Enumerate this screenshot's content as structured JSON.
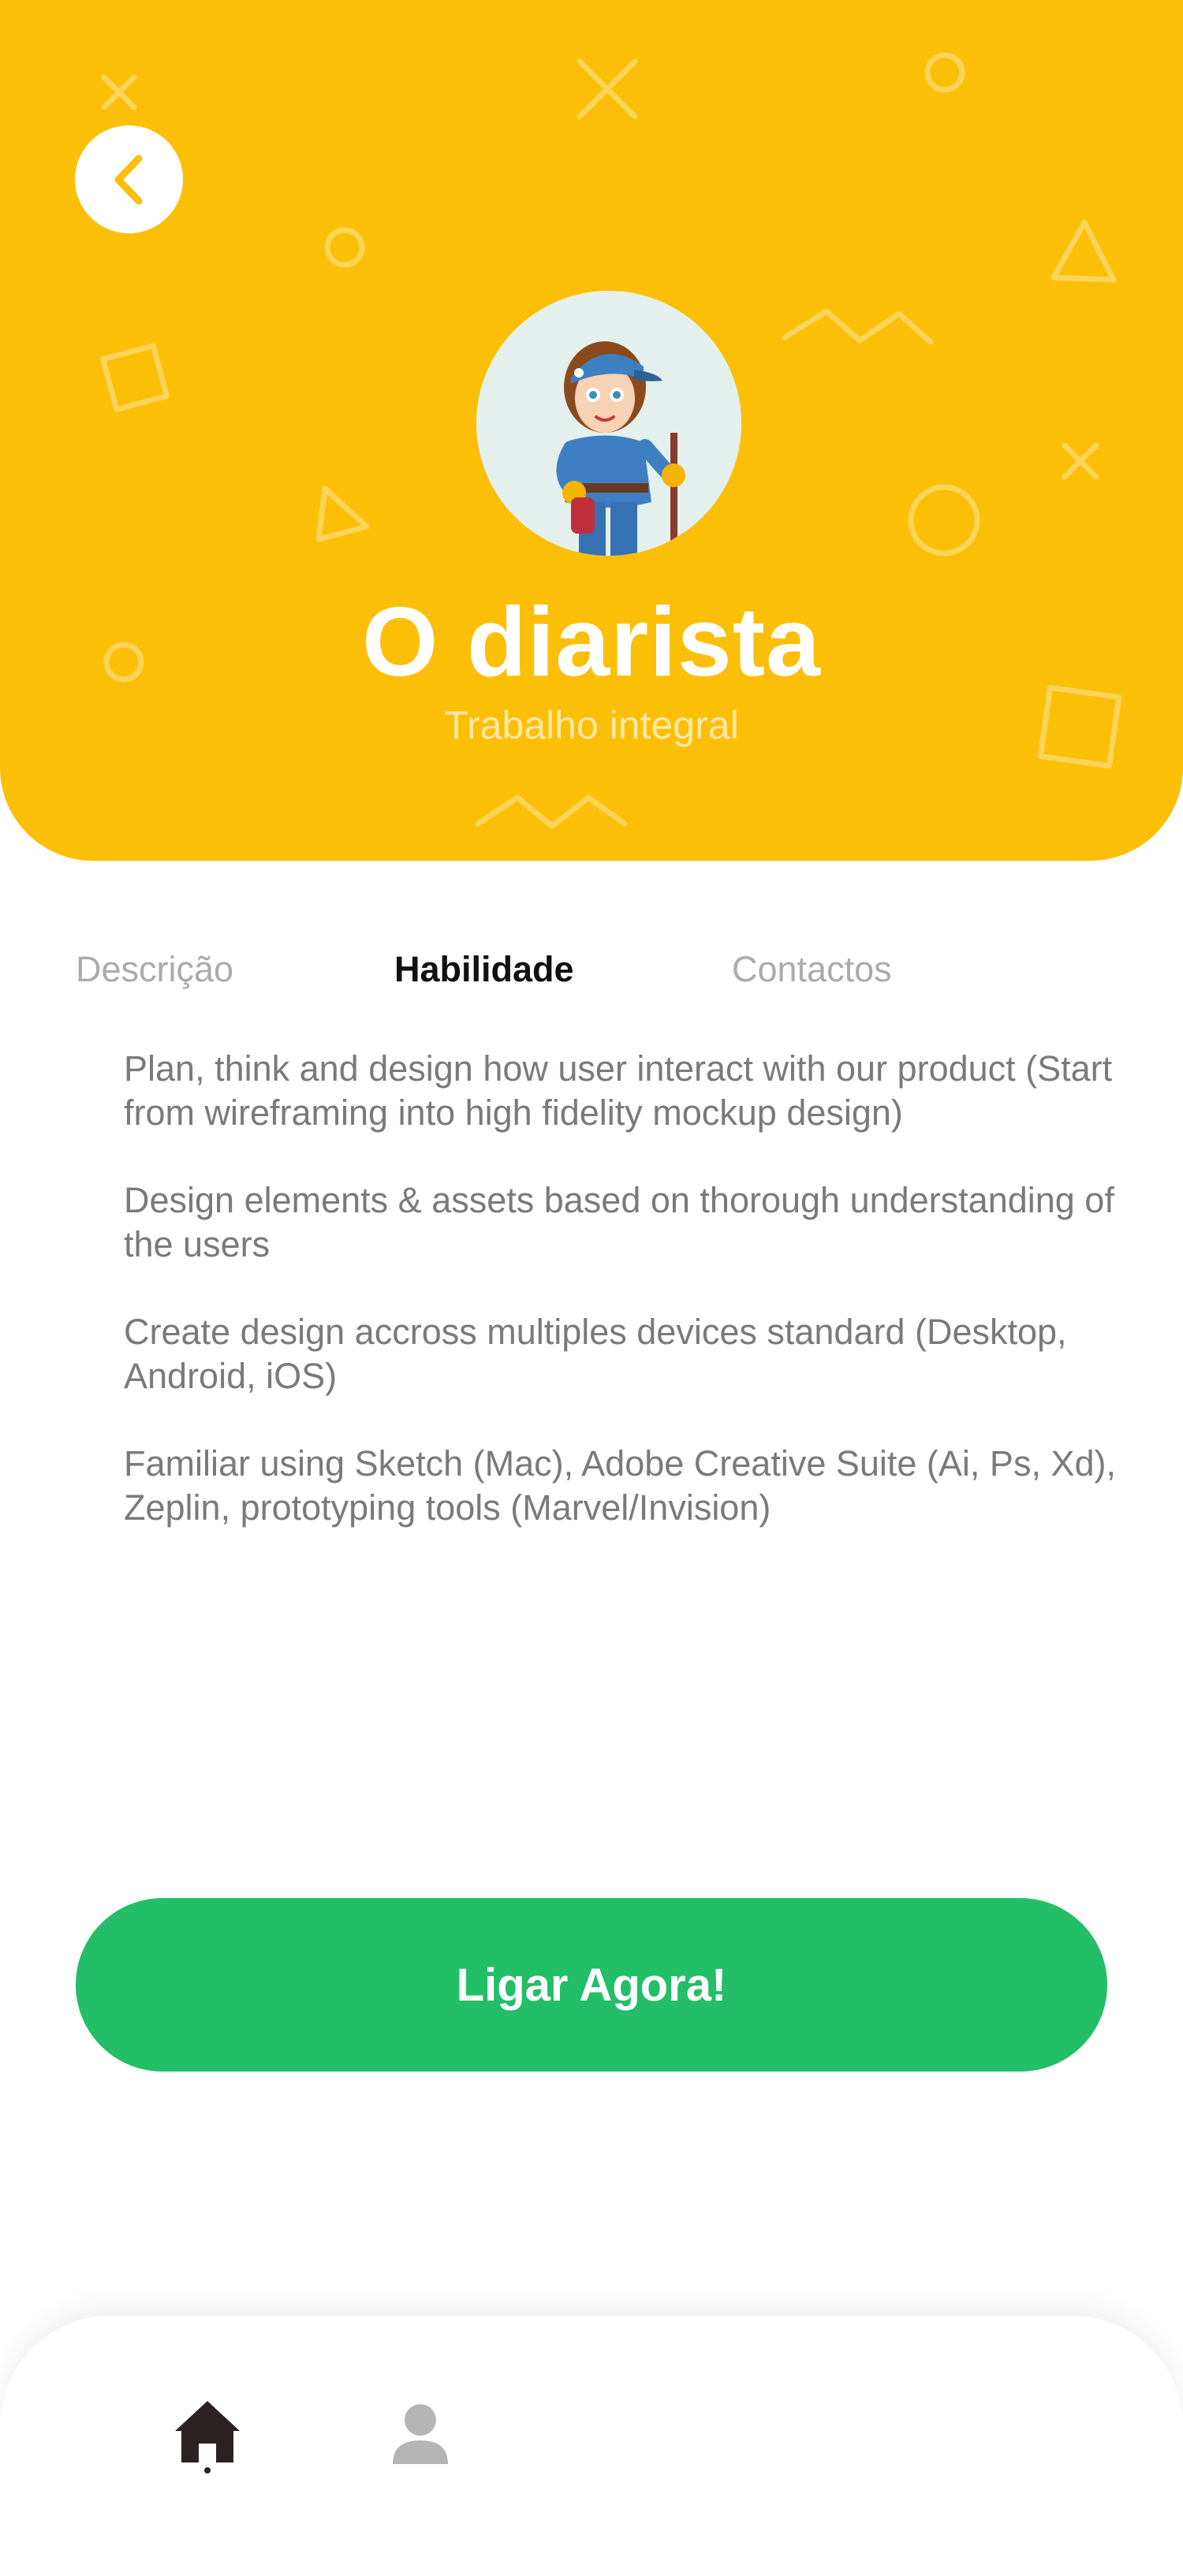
{
  "header": {
    "title": "O diarista",
    "subtitle": "Trabalho integral",
    "accent_color": "#FCBF08"
  },
  "back_button": {
    "icon": "chevron-left-icon"
  },
  "avatar": {
    "icon": "cleaning-lady-avatar"
  },
  "tabs": [
    {
      "label": "Descrição",
      "active": false
    },
    {
      "label": "Habilidade",
      "active": true
    },
    {
      "label": "Contactos",
      "active": false
    }
  ],
  "skills": [
    "Plan, think and design how user interact with our product (Start from wireframing into high fidelity mockup design)",
    "Design elements & assets based on thorough understanding of the users",
    "Create design accross multiples devices standard (Desktop, Android, iOS)",
    "Familiar using Sketch (Mac), Adobe Creative Suite (Ai, Ps, Xd), Zeplin, prototyping tools (Marvel/Invision)"
  ],
  "call_button": {
    "label": "Ligar Agora!",
    "color": "#22BE68"
  },
  "bottom_nav": {
    "items": [
      {
        "icon": "home-icon",
        "active": true
      },
      {
        "icon": "user-icon",
        "active": false
      }
    ]
  }
}
